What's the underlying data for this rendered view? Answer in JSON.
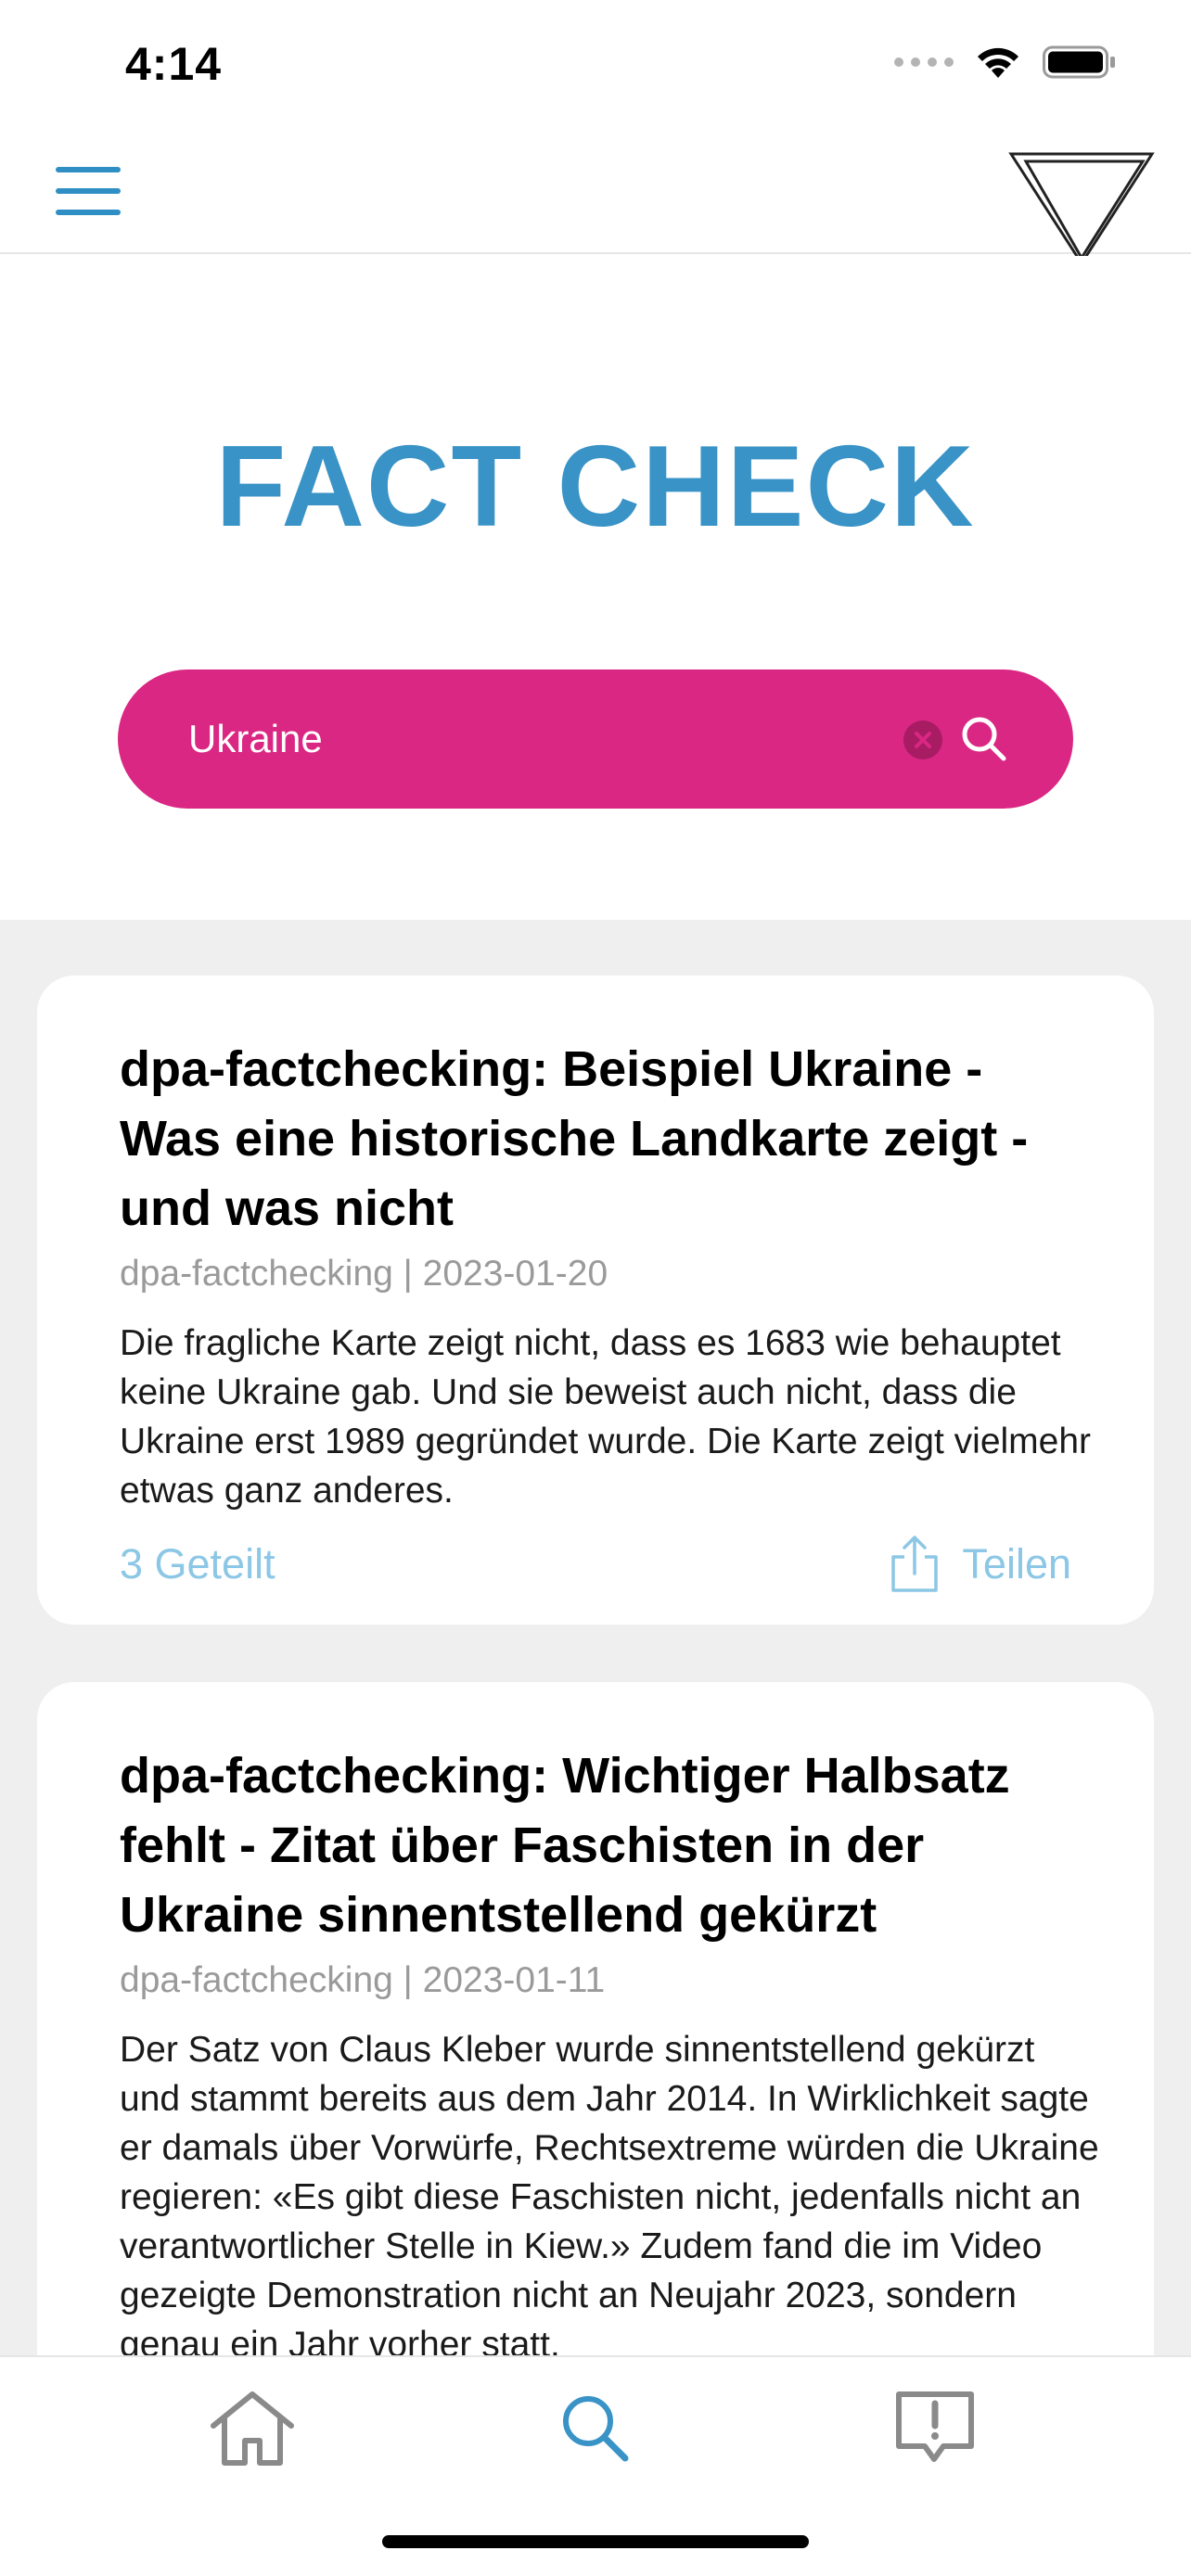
{
  "status_bar": {
    "time": "4:14",
    "signal_icon": "cellular-dots-icon",
    "wifi_icon": "wifi-icon",
    "battery_icon": "battery-icon"
  },
  "header": {
    "menu_icon": "hamburger-menu-icon",
    "logo_icon": "triangle-logo"
  },
  "hero": {
    "title": "FACT CHECK",
    "search": {
      "value": "Ukraine",
      "placeholder": "",
      "clear_icon": "clear-icon",
      "search_icon": "search-icon"
    }
  },
  "articles": [
    {
      "title": "dpa-factchecking: Beispiel Ukraine - Was eine historische Landkarte zeigt - und was nicht",
      "meta": "dpa-factchecking | 2023-01-20",
      "summary": "Die fragliche Karte zeigt nicht, dass es 1683 wie behauptet keine Ukraine gab. Und sie beweist auch nicht, dass die Ukraine erst 1989 gegründet wurde. Die Karte zeigt vielmehr etwas ganz anderes.",
      "shared": "3 Geteilt",
      "share_label": "Teilen"
    },
    {
      "title": "dpa-factchecking: Wichtiger Halbsatz fehlt - Zitat über Faschisten in der Ukraine sinnentstellend gekürzt",
      "meta": "dpa-factchecking | 2023-01-11",
      "summary": "Der Satz von Claus Kleber wurde sinnentstellend gekürzt und stammt bereits aus dem Jahr 2014. In Wirklichkeit sagte er damals über Vorwürfe, Rechtsextreme würden die Ukraine regieren: «Es gibt diese Faschisten nicht, jedenfalls nicht an verantwortlicher Stelle in Kiew.» Zudem fand die im Video gezeigte Demonstration nicht an Neujahr 2023, sondern genau ein Jahr vorher statt.",
      "shared": "",
      "share_label": ""
    }
  ],
  "tab_bar": {
    "tabs": [
      {
        "icon": "home-icon",
        "active": false
      },
      {
        "icon": "search-icon",
        "active": true
      },
      {
        "icon": "report-icon",
        "active": false
      }
    ]
  },
  "colors": {
    "brand_blue": "#3a93c6",
    "search_pink": "#da2783",
    "link_blue": "#8cc7e6",
    "inactive_gray": "#8a8a8a"
  }
}
